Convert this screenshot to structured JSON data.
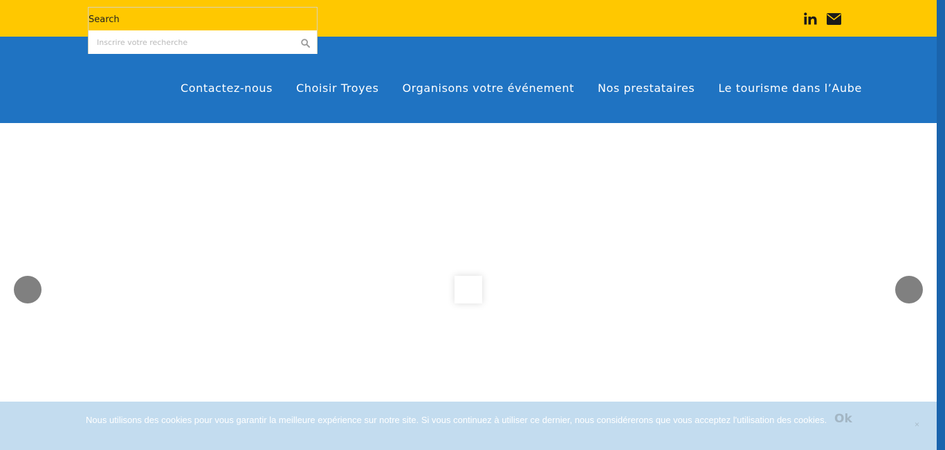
{
  "search": {
    "label": "Search",
    "placeholder": "Inscrire votre recherche"
  },
  "social": {
    "linkedin_icon": "linkedin-icon",
    "mail_icon": "envelope-icon"
  },
  "menu": [
    {
      "label": "Contactez-nous"
    },
    {
      "label": "Choisir Troyes"
    },
    {
      "label": "Organisons votre événement"
    },
    {
      "label": "Nos prestataires"
    },
    {
      "label": "Le tourisme dans l’Aube"
    }
  ],
  "cookie": {
    "text": "Nous utilisons des cookies pour vous garantir la meilleure expérience sur notre site. Si vous continuez à utiliser ce dernier, nous considérerons que vous acceptez l'utilisation des cookies.",
    "ok_label": "Ok",
    "close_glyph": "×"
  },
  "colors": {
    "topbar": "#ffc800",
    "navbar": "#1f73c2",
    "cookie_bar": "#c3dcef",
    "arrow": "#808080"
  }
}
